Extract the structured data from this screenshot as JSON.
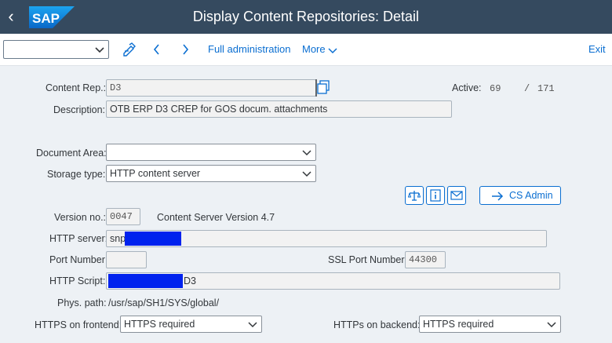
{
  "shell": {
    "title": "Display Content Repositories: Detail",
    "logo_text": "SAP"
  },
  "toolbar": {
    "select_value": "",
    "full_admin_label": "Full administration",
    "more_label": "More",
    "exit_label": "Exit"
  },
  "form": {
    "content_rep_label": "Content Rep.:",
    "content_rep_value": "D3",
    "active_label": "Active:",
    "active_count": "69",
    "active_separator": "/",
    "total_count": "171",
    "description_label": "Description:",
    "description_value": "OTB ERP D3 CREP for GOS docum. attachments",
    "document_area_label": "Document Area:",
    "document_area_value": "",
    "storage_type_label": "Storage type:",
    "storage_type_value": "HTTP content server",
    "cs_admin_label": "CS Admin",
    "version_label": "Version no.:",
    "version_value": "0047",
    "version_desc": "Content Server Version 4.7",
    "http_server_label": "HTTP server:",
    "http_server_value": "snp",
    "port_label": "Port Number:",
    "port_value": "",
    "ssl_port_label": "SSL Port Number:",
    "ssl_port_value": "44300",
    "http_script_label": "HTTP Script:",
    "http_script_suffix": "D3",
    "phys_path_label": "Phys. path:",
    "phys_path_value": "/usr/sap/SH1/SYS/global/",
    "https_frontend_label": "HTTPS on frontend:",
    "https_frontend_value": "HTTPS required",
    "https_backend_label": "HTTPs on backend:",
    "https_backend_value": "HTTPS required"
  },
  "colors": {
    "shell_bg": "#354a5f",
    "accent": "#0a6ed1",
    "redaction": "#0022ee"
  }
}
